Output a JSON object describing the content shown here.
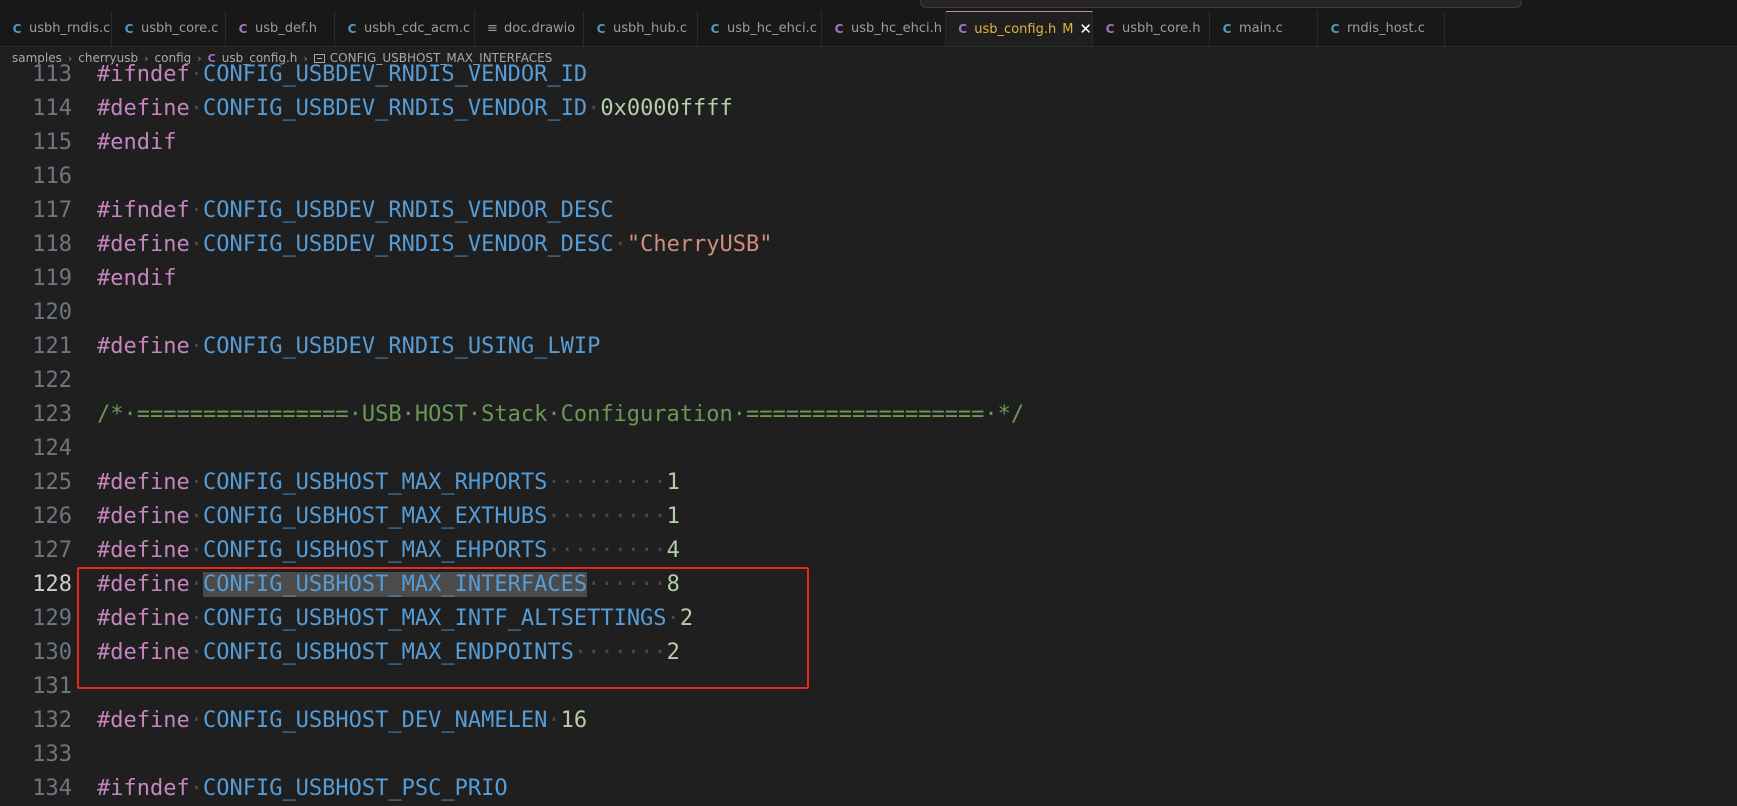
{
  "tabs": [
    {
      "icon": "C",
      "icon_name": "c-file-icon",
      "label": "usbh_rndis.c",
      "active": false
    },
    {
      "icon": "C",
      "icon_name": "c-file-icon",
      "label": "usbh_core.c",
      "active": false
    },
    {
      "icon": "C",
      "icon_name": "h-file-icon",
      "label": "usb_def.h",
      "active": false
    },
    {
      "icon": "C",
      "icon_name": "c-file-icon",
      "label": "usbh_cdc_acm.c",
      "active": false
    },
    {
      "icon": "≡",
      "icon_name": "document-icon",
      "label": "doc.drawio",
      "active": false
    },
    {
      "icon": "C",
      "icon_name": "c-file-icon",
      "label": "usbh_hub.c",
      "active": false
    },
    {
      "icon": "C",
      "icon_name": "c-file-icon",
      "label": "usb_hc_ehci.c",
      "active": false
    },
    {
      "icon": "C",
      "icon_name": "h-file-icon",
      "label": "usb_hc_ehci.h",
      "active": false
    },
    {
      "icon": "C",
      "icon_name": "h-file-icon",
      "label": "usb_config.h",
      "active": true,
      "modified": "M",
      "close": "✕"
    },
    {
      "icon": "C",
      "icon_name": "h-file-icon",
      "label": "usbh_core.h",
      "active": false
    },
    {
      "icon": "C",
      "icon_name": "c-file-icon",
      "label": "main.c",
      "active": false
    },
    {
      "icon": "C",
      "icon_name": "c-file-icon",
      "label": "rndis_host.c",
      "active": false
    }
  ],
  "breadcrumb": {
    "parts": [
      "samples",
      "cherryusb",
      "config"
    ],
    "file_icon": "C",
    "file": "usb_config.h",
    "symbol": "CONFIG_USBHOST_MAX_INTERFACES"
  },
  "editor": {
    "current_line": "128",
    "lines": [
      {
        "n": "113",
        "tokens": [
          [
            "kw",
            "#ifndef"
          ],
          [
            "ws",
            "·"
          ],
          [
            "mac",
            "CONFIG_USBDEV_RNDIS_VENDOR_ID"
          ]
        ]
      },
      {
        "n": "114",
        "tokens": [
          [
            "kw",
            "#define"
          ],
          [
            "ws",
            "·"
          ],
          [
            "mac",
            "CONFIG_USBDEV_RNDIS_VENDOR_ID"
          ],
          [
            "ws",
            "·"
          ],
          [
            "num",
            "0x0000ffff"
          ]
        ]
      },
      {
        "n": "115",
        "tokens": [
          [
            "kw",
            "#endif"
          ]
        ]
      },
      {
        "n": "116",
        "tokens": []
      },
      {
        "n": "117",
        "tokens": [
          [
            "kw",
            "#ifndef"
          ],
          [
            "ws",
            "·"
          ],
          [
            "mac",
            "CONFIG_USBDEV_RNDIS_VENDOR_DESC"
          ]
        ]
      },
      {
        "n": "118",
        "tokens": [
          [
            "kw",
            "#define"
          ],
          [
            "ws",
            "·"
          ],
          [
            "mac",
            "CONFIG_USBDEV_RNDIS_VENDOR_DESC"
          ],
          [
            "ws",
            "·"
          ],
          [
            "str",
            "\"CherryUSB\""
          ]
        ]
      },
      {
        "n": "119",
        "tokens": [
          [
            "kw",
            "#endif"
          ]
        ]
      },
      {
        "n": "120",
        "tokens": []
      },
      {
        "n": "121",
        "tokens": [
          [
            "kw",
            "#define"
          ],
          [
            "ws",
            "·"
          ],
          [
            "mac",
            "CONFIG_USBDEV_RNDIS_USING_LWIP"
          ]
        ]
      },
      {
        "n": "122",
        "tokens": []
      },
      {
        "n": "123",
        "tokens": [
          [
            "cmt",
            "/*·================·USB·HOST·Stack·Configuration·==================·*/"
          ]
        ]
      },
      {
        "n": "124",
        "tokens": []
      },
      {
        "n": "125",
        "tokens": [
          [
            "kw",
            "#define"
          ],
          [
            "ws",
            "·"
          ],
          [
            "mac",
            "CONFIG_USBHOST_MAX_RHPORTS"
          ],
          [
            "ws",
            "·········"
          ],
          [
            "num",
            "1"
          ]
        ]
      },
      {
        "n": "126",
        "tokens": [
          [
            "kw",
            "#define"
          ],
          [
            "ws",
            "·"
          ],
          [
            "mac",
            "CONFIG_USBHOST_MAX_EXTHUBS"
          ],
          [
            "ws",
            "·········"
          ],
          [
            "num",
            "1"
          ]
        ]
      },
      {
        "n": "127",
        "tokens": [
          [
            "kw",
            "#define"
          ],
          [
            "ws",
            "·"
          ],
          [
            "mac",
            "CONFIG_USBHOST_MAX_EHPORTS"
          ],
          [
            "ws",
            "·········"
          ],
          [
            "num",
            "4"
          ]
        ]
      },
      {
        "n": "128",
        "tokens": [
          [
            "kw",
            "#define"
          ],
          [
            "ws",
            "·"
          ],
          [
            "sel",
            "CONFIG_USBHOST_MAX_INTERFACES"
          ],
          [
            "ws",
            "······"
          ],
          [
            "num",
            "8"
          ]
        ]
      },
      {
        "n": "129",
        "tokens": [
          [
            "kw",
            "#define"
          ],
          [
            "ws",
            "·"
          ],
          [
            "mac",
            "CONFIG_USBHOST_MAX_INTF_ALTSETTINGS"
          ],
          [
            "ws",
            "·"
          ],
          [
            "num",
            "2"
          ]
        ]
      },
      {
        "n": "130",
        "tokens": [
          [
            "kw",
            "#define"
          ],
          [
            "ws",
            "·"
          ],
          [
            "mac",
            "CONFIG_USBHOST_MAX_ENDPOINTS"
          ],
          [
            "ws",
            "·······"
          ],
          [
            "num",
            "2"
          ]
        ]
      },
      {
        "n": "131",
        "tokens": []
      },
      {
        "n": "132",
        "tokens": [
          [
            "kw",
            "#define"
          ],
          [
            "ws",
            "·"
          ],
          [
            "mac",
            "CONFIG_USBHOST_DEV_NAMELEN"
          ],
          [
            "ws",
            "·"
          ],
          [
            "num",
            "16"
          ]
        ]
      },
      {
        "n": "133",
        "tokens": []
      },
      {
        "n": "134",
        "tokens": [
          [
            "kw",
            "#ifndef"
          ],
          [
            "ws",
            "·"
          ],
          [
            "mac",
            "CONFIG_USBHOST_PSC_PRIO"
          ]
        ]
      }
    ]
  },
  "colors": {
    "keyword": "#c586c0",
    "macro": "#569cd6",
    "number": "#b5cea8",
    "string": "#ce9178",
    "comment": "#6a9955",
    "highlight_box": "#e8271f",
    "active_tab_text": "#e3b341"
  }
}
